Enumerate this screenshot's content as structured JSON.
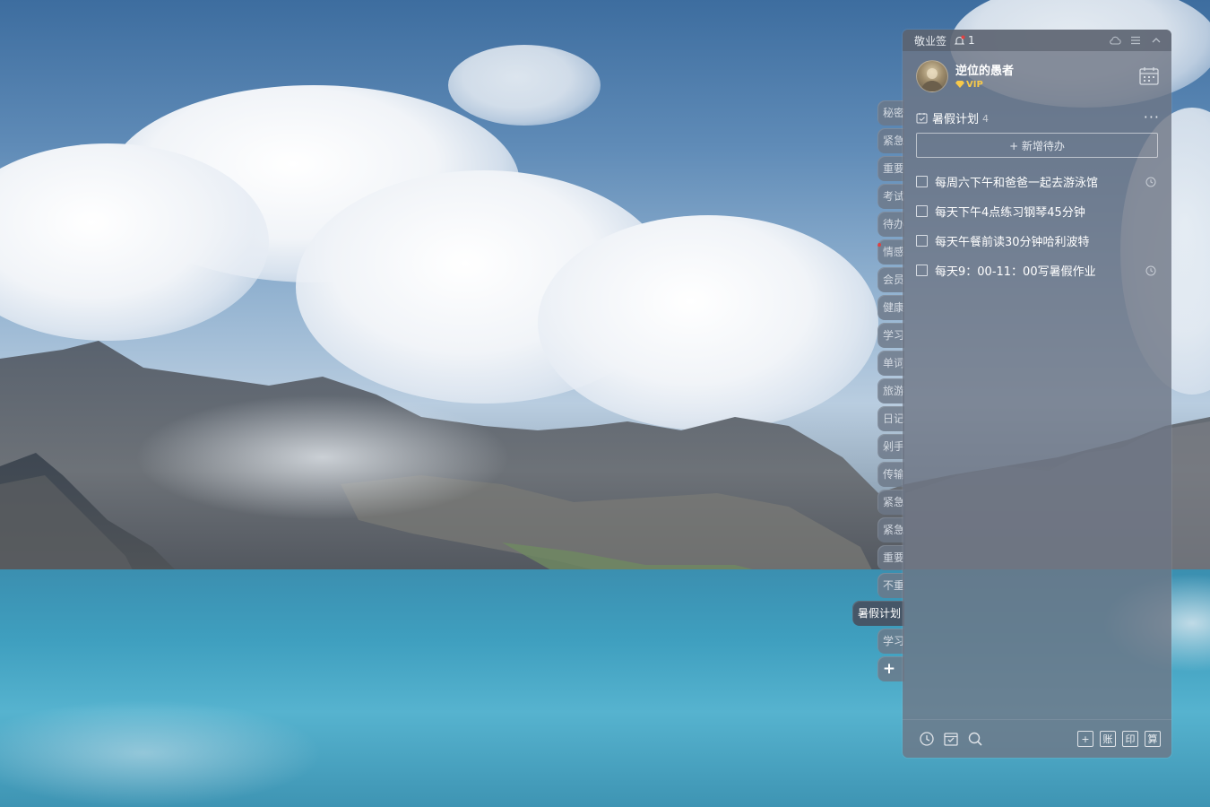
{
  "app": {
    "title": "敬业签",
    "notification_count": "1"
  },
  "user": {
    "name": "逆位的愚者",
    "badge": "VIP"
  },
  "category_tabs": [
    {
      "label": "秘密",
      "active": false
    },
    {
      "label": "紧急",
      "active": false
    },
    {
      "label": "重要",
      "active": false
    },
    {
      "label": "考试",
      "active": false
    },
    {
      "label": "待办",
      "active": false
    },
    {
      "label": "情感",
      "active": false,
      "unread_dot": true
    },
    {
      "label": "会员",
      "active": false
    },
    {
      "label": "健康",
      "active": false
    },
    {
      "label": "学习",
      "active": false
    },
    {
      "label": "单词",
      "active": false
    },
    {
      "label": "旅游",
      "active": false
    },
    {
      "label": "日记",
      "active": false
    },
    {
      "label": "剁手",
      "active": false
    },
    {
      "label": "传输",
      "active": false
    },
    {
      "label": "紧急",
      "active": false
    },
    {
      "label": "紧急",
      "active": false
    },
    {
      "label": "重要",
      "active": false
    },
    {
      "label": "不重",
      "active": false
    },
    {
      "label": "暑假计划",
      "active": true
    },
    {
      "label": "学习",
      "active": false
    },
    {
      "label": "+",
      "active": false,
      "is_add": true
    }
  ],
  "list": {
    "title": "暑假计划",
    "count": "4",
    "add_label": "+ 新增待办",
    "more_icon": "ellipsis-icon"
  },
  "todos": [
    {
      "text": "每周六下午和爸爸一起去游泳馆",
      "has_reminder": true
    },
    {
      "text": "每天下午4点练习钢琴45分钟",
      "has_reminder": false
    },
    {
      "text": "每天午餐前读30分钟哈利波特",
      "has_reminder": false
    },
    {
      "text": "每天9：00-11：00写暑假作业",
      "has_reminder": true
    }
  ],
  "bottom_toolbar": {
    "left_icons": [
      "clock-icon",
      "calendar-check-icon",
      "search-icon"
    ],
    "right_buttons": [
      "+",
      "账",
      "印",
      "算"
    ]
  },
  "colors": {
    "panel_bg": "#6e7684",
    "vip_gold": "#f7c94a",
    "unread_dot": "#e04040"
  }
}
